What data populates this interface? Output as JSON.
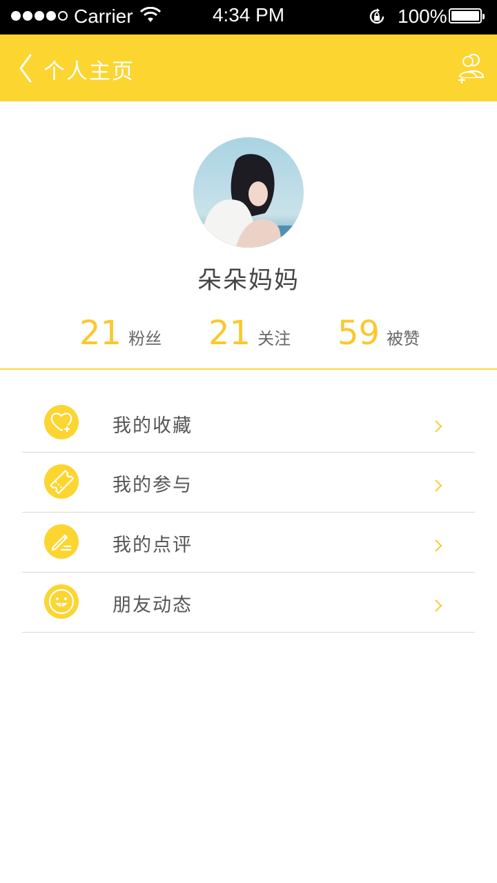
{
  "status_bar": {
    "carrier": "Carrier",
    "time": "4:34 PM",
    "battery": "100%"
  },
  "nav": {
    "title": "个人主页"
  },
  "profile": {
    "name": "朵朵妈妈"
  },
  "stats": [
    {
      "value": "21",
      "label": "粉丝"
    },
    {
      "value": "21",
      "label": "关注"
    },
    {
      "value": "59",
      "label": "被赞"
    }
  ],
  "menu": [
    {
      "label": "我的收藏",
      "icon": "heart-plus-icon"
    },
    {
      "label": "我的参与",
      "icon": "ticket-icon"
    },
    {
      "label": "我的点评",
      "icon": "pencil-icon"
    },
    {
      "label": "朋友动态",
      "icon": "smiley-icon"
    }
  ],
  "colors": {
    "accent": "#fdd531",
    "number": "#fbc82c",
    "text": "#555555"
  }
}
